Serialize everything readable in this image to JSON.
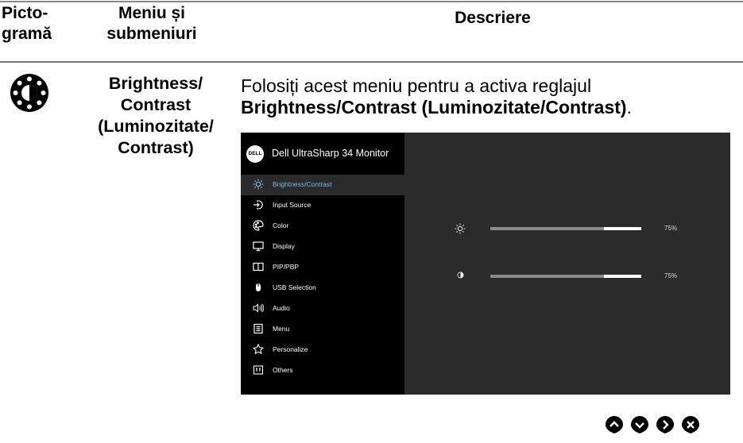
{
  "table": {
    "headers": {
      "picto": "Picto-gramă",
      "menu": "Meniu și submeniuri",
      "desc": "Descriere"
    }
  },
  "row": {
    "icon": "brightness-contrast-icon",
    "menu_name": "Brightness/ Contrast (Luminozitate/ Contrast)",
    "desc_line1": "Folosiți acest meniu pentru a activa reglajul",
    "desc_bold": "Brightness/Contrast (Luminozitate/Contrast)",
    "desc_end": "."
  },
  "osd": {
    "logo_text": "DELL",
    "title": "Dell UltraSharp 34 Monitor",
    "items": [
      {
        "label": "Brightness/Contrast",
        "icon": "sun-icon",
        "active": true
      },
      {
        "label": "Input Source",
        "icon": "input-source-icon",
        "active": false
      },
      {
        "label": "Color",
        "icon": "color-palette-icon",
        "active": false
      },
      {
        "label": "Display",
        "icon": "display-icon",
        "active": false
      },
      {
        "label": "PIP/PBP",
        "icon": "pip-pbp-icon",
        "active": false
      },
      {
        "label": "USB Selection",
        "icon": "usb-mouse-icon",
        "active": false
      },
      {
        "label": "Audio",
        "icon": "speaker-icon",
        "active": false
      },
      {
        "label": "Menu",
        "icon": "menu-list-icon",
        "active": false
      },
      {
        "label": "Personalize",
        "icon": "star-icon",
        "active": false
      },
      {
        "label": "Others",
        "icon": "others-icon",
        "active": false
      }
    ],
    "brightness": {
      "value": 0.75,
      "label": "75%"
    },
    "contrast": {
      "value": 0.75,
      "label": "75%"
    }
  },
  "nav_buttons": [
    "up-button",
    "down-button",
    "right-button",
    "close-button"
  ],
  "colors": {
    "active_label": "#7fb3e6",
    "osd_bg": "#2b2b2b",
    "osd_menu_bg": "#000000",
    "slider_fill": "#8a8a8a"
  }
}
